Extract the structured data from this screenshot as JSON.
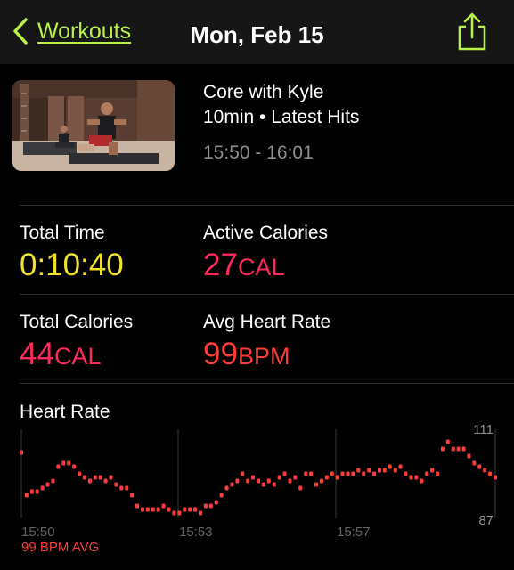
{
  "nav": {
    "back_label": "Workouts",
    "title": "Mon, Feb 15"
  },
  "workout": {
    "title": "Core with Kyle",
    "meta": "10min • Latest Hits",
    "time_range": "15:50 - 16:01"
  },
  "stats": {
    "total_time": {
      "label": "Total Time",
      "value": "0:10:40"
    },
    "active_calories": {
      "label": "Active Calories",
      "value": "27",
      "unit": "CAL"
    },
    "total_calories": {
      "label": "Total Calories",
      "value": "44",
      "unit": "CAL"
    },
    "avg_heart_rate": {
      "label": "Avg Heart Rate",
      "value": "99",
      "unit": "BPM"
    }
  },
  "heart_rate": {
    "title": "Heart Rate",
    "avg_label": "99 BPM AVG"
  },
  "colors": {
    "accent": "#b7f248",
    "yellow": "#f2e227",
    "pink": "#fb2c5a",
    "red": "#fc3d39"
  },
  "icons": [
    "chevron-left-icon",
    "share-icon"
  ],
  "chart_data": {
    "type": "scatter",
    "x_ticks": [
      "15:50",
      "15:53",
      "15:57"
    ],
    "y_ticks": [
      "111",
      "87"
    ],
    "ylim": [
      87,
      111
    ],
    "series": [
      {
        "values": [
          [
            0.0,
            105
          ],
          [
            0.2,
            93
          ],
          [
            0.4,
            94
          ],
          [
            0.6,
            94
          ],
          [
            0.8,
            95
          ],
          [
            1.0,
            96
          ],
          [
            1.2,
            97
          ],
          [
            1.4,
            101
          ],
          [
            1.6,
            102
          ],
          [
            1.8,
            102
          ],
          [
            2.0,
            101
          ],
          [
            2.2,
            99
          ],
          [
            2.4,
            98
          ],
          [
            2.6,
            97
          ],
          [
            2.8,
            98
          ],
          [
            3.0,
            98
          ],
          [
            3.2,
            97
          ],
          [
            3.4,
            98
          ],
          [
            3.6,
            96
          ],
          [
            3.8,
            95
          ],
          [
            4.0,
            95
          ],
          [
            4.2,
            93
          ],
          [
            4.4,
            90
          ],
          [
            4.6,
            89
          ],
          [
            4.8,
            89
          ],
          [
            5.0,
            89
          ],
          [
            5.2,
            89
          ],
          [
            5.4,
            90
          ],
          [
            5.6,
            89
          ],
          [
            5.8,
            88
          ],
          [
            6.0,
            88
          ],
          [
            6.2,
            89
          ],
          [
            6.4,
            89
          ],
          [
            6.6,
            89
          ],
          [
            6.8,
            88
          ],
          [
            7.0,
            90
          ],
          [
            7.2,
            90
          ],
          [
            7.4,
            91
          ],
          [
            7.6,
            93
          ],
          [
            7.8,
            95
          ],
          [
            8.0,
            96
          ],
          [
            8.2,
            97
          ],
          [
            8.4,
            99
          ],
          [
            8.6,
            97
          ],
          [
            8.8,
            98
          ],
          [
            9.0,
            97
          ],
          [
            9.2,
            96
          ],
          [
            9.4,
            97
          ],
          [
            9.6,
            96
          ],
          [
            9.8,
            98
          ],
          [
            10.0,
            99
          ],
          [
            10.2,
            97
          ],
          [
            10.4,
            98
          ],
          [
            10.6,
            95
          ],
          [
            10.8,
            99
          ],
          [
            11.0,
            99
          ],
          [
            11.2,
            96
          ],
          [
            11.4,
            97
          ],
          [
            11.6,
            98
          ],
          [
            11.8,
            99
          ],
          [
            12.0,
            98
          ],
          [
            12.2,
            99
          ],
          [
            12.4,
            99
          ],
          [
            12.6,
            99
          ],
          [
            12.8,
            100
          ],
          [
            13.0,
            99
          ],
          [
            13.2,
            100
          ],
          [
            13.4,
            99
          ],
          [
            13.6,
            100
          ],
          [
            13.8,
            100
          ],
          [
            14.0,
            101
          ],
          [
            14.2,
            100
          ],
          [
            14.4,
            101
          ],
          [
            14.6,
            99
          ],
          [
            14.8,
            98
          ],
          [
            15.0,
            98
          ],
          [
            15.2,
            97
          ],
          [
            15.4,
            99
          ],
          [
            15.6,
            100
          ],
          [
            15.8,
            99
          ],
          [
            16.0,
            106
          ],
          [
            16.2,
            108
          ],
          [
            16.4,
            106
          ],
          [
            16.6,
            106
          ],
          [
            16.8,
            106
          ],
          [
            17.0,
            104
          ],
          [
            17.2,
            102
          ],
          [
            17.4,
            101
          ],
          [
            17.6,
            100
          ],
          [
            17.8,
            99
          ],
          [
            18.0,
            98
          ]
        ]
      }
    ]
  }
}
